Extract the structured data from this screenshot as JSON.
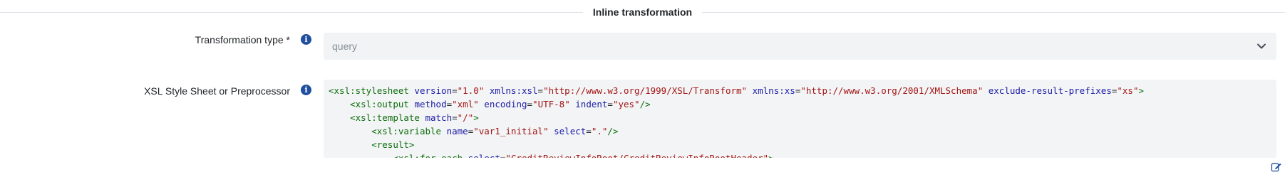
{
  "section": {
    "title": "Inline transformation"
  },
  "fields": {
    "transformation_type": {
      "label": "Transformation type *",
      "value": "query",
      "info_icon": "info-circle-icon"
    },
    "xsl": {
      "label": "XSL Style Sheet or Preprocessor",
      "info_icon": "info-circle-icon",
      "code_lines": [
        "<xsl:stylesheet version=\"1.0\" xmlns:xsl=\"http://www.w3.org/1999/XSL/Transform\" xmlns:xs=\"http://www.w3.org/2001/XMLSchema\" exclude-result-prefixes=\"xs\">",
        "    <xsl:output method=\"xml\" encoding=\"UTF-8\" indent=\"yes\"/>",
        "    <xsl:template match=\"/\">",
        "        <xsl:variable name=\"var1_initial\" select=\".\"/>",
        "        <result>",
        "            <xsl:for-each select=\"CreditReviewInfoRoot/CreditReviewInfoRootHeader\">"
      ]
    }
  },
  "icons": {
    "select_chevron": "chevron-down-icon",
    "edit": "edit-icon"
  },
  "colors": {
    "info_icon": "#1f4f9e",
    "xml_tag": "#0c6e0c",
    "xml_attr": "#1a1aa6",
    "xml_value": "#a31515"
  }
}
